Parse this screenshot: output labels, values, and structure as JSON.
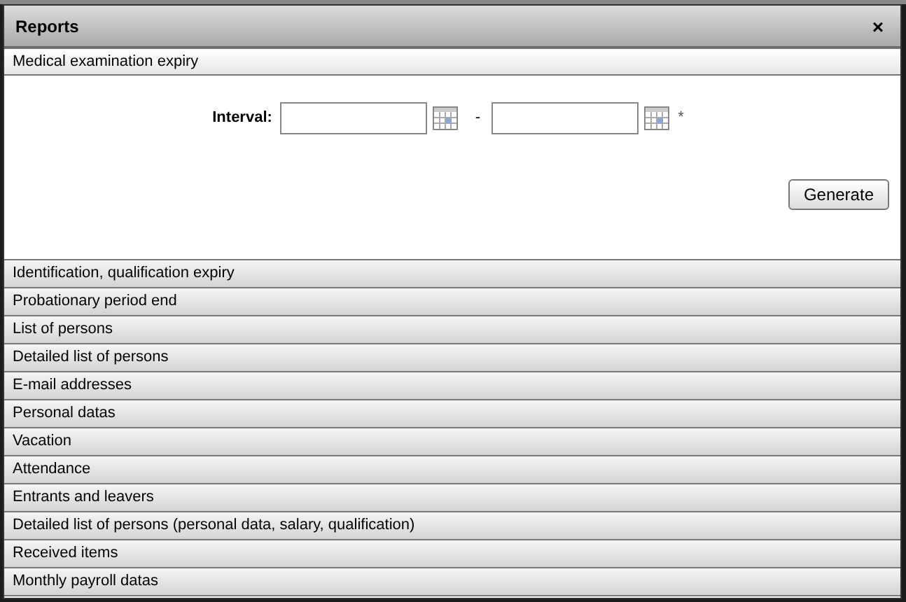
{
  "window": {
    "title": "Reports",
    "close": "×"
  },
  "sections": [
    {
      "label": "Medical examination expiry",
      "expanded": true
    },
    {
      "label": "Identification, qualification expiry",
      "expanded": false
    },
    {
      "label": "Probationary period end",
      "expanded": false
    },
    {
      "label": "List of persons",
      "expanded": false
    },
    {
      "label": "Detailed list of persons",
      "expanded": false
    },
    {
      "label": "E-mail addresses",
      "expanded": false
    },
    {
      "label": "Personal datas",
      "expanded": false
    },
    {
      "label": "Vacation",
      "expanded": false
    },
    {
      "label": "Attendance",
      "expanded": false
    },
    {
      "label": "Entrants and leavers",
      "expanded": false
    },
    {
      "label": "Detailed list of persons (personal data, salary, qualification)",
      "expanded": false
    },
    {
      "label": "Received items",
      "expanded": false
    },
    {
      "label": "Monthly payroll datas",
      "expanded": false
    }
  ],
  "form": {
    "label": "Interval:",
    "separator": "-",
    "required_mark": "*",
    "button": "Generate"
  }
}
